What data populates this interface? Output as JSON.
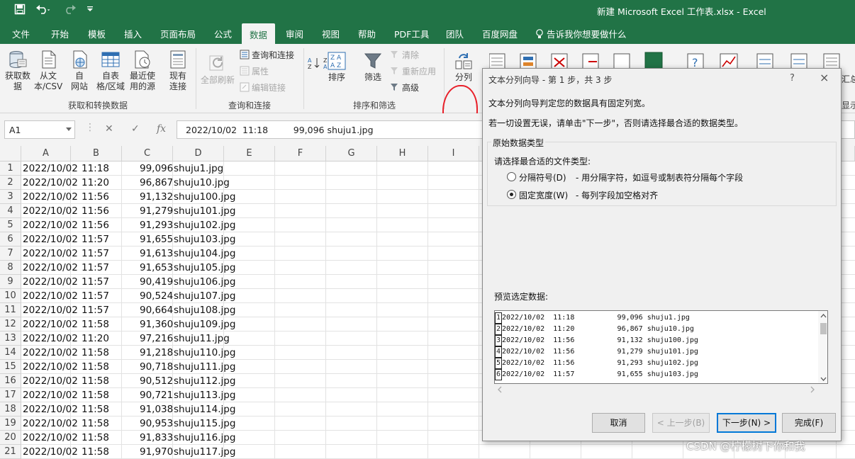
{
  "window": {
    "title": "新建 Microsoft Excel 工作表.xlsx  -  Excel"
  },
  "tabs": [
    "文件",
    "开始",
    "模板",
    "插入",
    "页面布局",
    "公式",
    "数据",
    "审阅",
    "视图",
    "帮助",
    "PDF工具",
    "团队",
    "百度网盘"
  ],
  "tell_me": "告诉我你想要做什么",
  "ribbon": {
    "get_data": "获取数\n据",
    "from_csv": "从文\n本/CSV",
    "from_web": "自\n网站",
    "from_table": "自表\n格/区域",
    "recent": "最近使\n用的源",
    "existing": "现有\n连接",
    "refresh_all": "全部刷新",
    "queries": "查询和连接",
    "properties": "属性",
    "edit_links": "编辑链接",
    "sort": "排序",
    "filter": "筛选",
    "clear": "清除",
    "reapply": "重新应用",
    "advanced": "高级",
    "text_to_columns": "分列",
    "group1": "获取和转换数据",
    "group2": "查询和连接",
    "group3": "排序和筛选",
    "right_partial1": "汇总",
    "right_partial2": "显示"
  },
  "formula_bar": {
    "name_box": "A1",
    "fx": "fx",
    "content": "2022/10/02  11:18         99,096 shuju1.jpg"
  },
  "columns": [
    "A",
    "B",
    "C",
    "D",
    "E",
    "F",
    "G",
    "H",
    "I"
  ],
  "rows": [
    {
      "n": "1",
      "date": "2022/10/02",
      "time": "11:18",
      "size": "99,096",
      "name": "shuju1.jpg"
    },
    {
      "n": "2",
      "date": "2022/10/02",
      "time": "11:20",
      "size": "96,867",
      "name": "shuju10.jpg"
    },
    {
      "n": "3",
      "date": "2022/10/02",
      "time": "11:56",
      "size": "91,132",
      "name": "shuju100.jpg"
    },
    {
      "n": "4",
      "date": "2022/10/02",
      "time": "11:56",
      "size": "91,279",
      "name": "shuju101.jpg"
    },
    {
      "n": "5",
      "date": "2022/10/02",
      "time": "11:56",
      "size": "91,293",
      "name": "shuju102.jpg"
    },
    {
      "n": "6",
      "date": "2022/10/02",
      "time": "11:57",
      "size": "91,655",
      "name": "shuju103.jpg"
    },
    {
      "n": "7",
      "date": "2022/10/02",
      "time": "11:57",
      "size": "91,613",
      "name": "shuju104.jpg"
    },
    {
      "n": "8",
      "date": "2022/10/02",
      "time": "11:57",
      "size": "91,653",
      "name": "shuju105.jpg"
    },
    {
      "n": "9",
      "date": "2022/10/02",
      "time": "11:57",
      "size": "90,419",
      "name": "shuju106.jpg"
    },
    {
      "n": "10",
      "date": "2022/10/02",
      "time": "11:57",
      "size": "90,524",
      "name": "shuju107.jpg"
    },
    {
      "n": "11",
      "date": "2022/10/02",
      "time": "11:57",
      "size": "90,664",
      "name": "shuju108.jpg"
    },
    {
      "n": "12",
      "date": "2022/10/02",
      "time": "11:58",
      "size": "91,360",
      "name": "shuju109.jpg"
    },
    {
      "n": "13",
      "date": "2022/10/02",
      "time": "11:20",
      "size": "97,216",
      "name": "shuju11.jpg"
    },
    {
      "n": "14",
      "date": "2022/10/02",
      "time": "11:58",
      "size": "91,218",
      "name": "shuju110.jpg"
    },
    {
      "n": "15",
      "date": "2022/10/02",
      "time": "11:58",
      "size": "90,718",
      "name": "shuju111.jpg"
    },
    {
      "n": "16",
      "date": "2022/10/02",
      "time": "11:58",
      "size": "90,512",
      "name": "shuju112.jpg"
    },
    {
      "n": "17",
      "date": "2022/10/02",
      "time": "11:58",
      "size": "90,721",
      "name": "shuju113.jpg"
    },
    {
      "n": "18",
      "date": "2022/10/02",
      "time": "11:58",
      "size": "91,038",
      "name": "shuju114.jpg"
    },
    {
      "n": "19",
      "date": "2022/10/02",
      "time": "11:58",
      "size": "90,953",
      "name": "shuju115.jpg"
    },
    {
      "n": "20",
      "date": "2022/10/02",
      "time": "11:58",
      "size": "91,833",
      "name": "shuju116.jpg"
    },
    {
      "n": "21",
      "date": "2022/10/02",
      "time": "11:58",
      "size": "91,970",
      "name": "shuju117.jpg"
    }
  ],
  "dialog": {
    "title": "文本分列向导 - 第 1 步，共 3 步",
    "help": "?",
    "close": "×",
    "intro1": "文本分列向导判定您的数据具有固定列宽。",
    "intro2": "若一切设置无误，请单击\"下一步\"，否则请选择最合适的数据类型。",
    "group_title": "原始数据类型",
    "choose": "请选择最合适的文件类型:",
    "opt1": "分隔符号(D)",
    "opt1_desc": "- 用分隔字符，如逗号或制表符分隔每个字段",
    "opt2": "固定宽度(W)",
    "opt2_desc": "- 每列字段加空格对齐",
    "selected": "固定宽度(W)",
    "preview_label": "预览选定数据:",
    "preview": [
      "2022/10/02  11:18          99,096 shuju1.jpg",
      "2022/10/02  11:20          96,867 shuju10.jpg",
      "2022/10/02  11:56          91,132 shuju100.jpg",
      "2022/10/02  11:56          91,279 shuju101.jpg",
      "2022/10/02  11:56          91,293 shuju102.jpg",
      "2022/10/02  11:57          91,655 shuju103.jpg"
    ],
    "preview_nums": [
      "1",
      "2",
      "3",
      "4",
      "5",
      "6"
    ],
    "cancel": "取消",
    "back": "< 上一步(B)",
    "next": "下一步(N) >",
    "finish": "完成(F)"
  },
  "watermark": "CSDN @柠檬树下你和我",
  "colors": {
    "excel_green": "#217346",
    "annotation_red": "#e8202a"
  }
}
